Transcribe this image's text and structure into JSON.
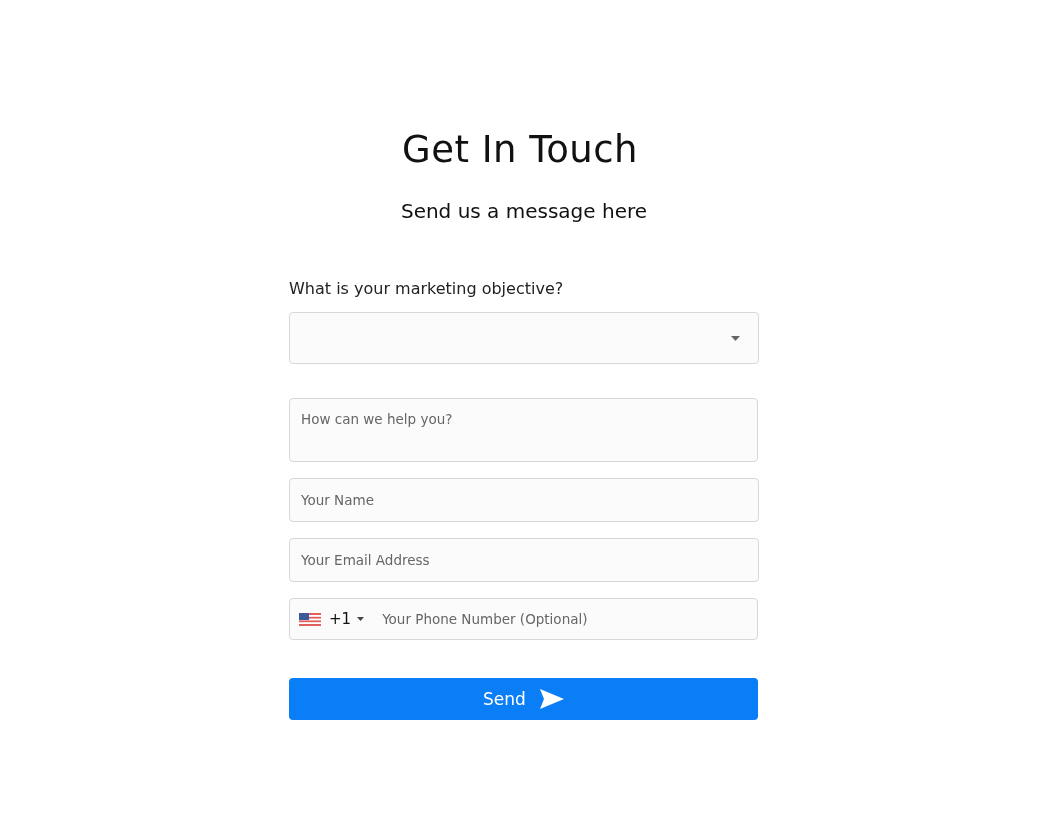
{
  "title": "Get In Touch",
  "subtitle": "Send us a message here",
  "objective": {
    "label": "What is your marketing objective?"
  },
  "message": {
    "placeholder": "How can we help you?"
  },
  "name": {
    "placeholder": "Your Name"
  },
  "email": {
    "placeholder": "Your Email Address"
  },
  "phone": {
    "dial_code": "+1",
    "placeholder": "Your Phone Number (Optional)"
  },
  "send_button": {
    "label": "Send"
  }
}
